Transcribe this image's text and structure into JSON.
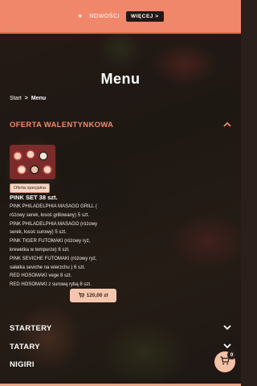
{
  "promo": {
    "icon": "star-icon",
    "text": "NOWOŚCI",
    "more_label": "WIĘCEJ >"
  },
  "page": {
    "title": "Menu"
  },
  "breadcrumb": {
    "home": "Start",
    "separator": ">",
    "current": "Menu"
  },
  "sections": {
    "oferta": "OFERTA WALENTYNKOWA",
    "startery": "STARTERY",
    "tatary": "TATARY",
    "nigiri": "NIGIRI"
  },
  "product": {
    "badge": "Oferta specjalna",
    "name": "PINK SET 38 szt.",
    "description_lines": [
      "PINK PHILADELPHIA MASAGO GRILL (",
      "różowy serek, łosoś grillowany) 5 szt.",
      "PINK PHILADELPHIA MASAGO (różowy",
      "serek, łosoś surowy) 5 szt.",
      "PINK TIGER FUTOMAKI (różowy ryż,",
      "krewetka w tempurze) 6 szt.",
      "PINK SEVICHE FUTOMAKI (różowy ryż,",
      "sałatka seviche na wierzchu ) 6 szt.",
      "RED HOSOMAKI vege 8 szt.",
      "RED HOSOMAKI z surową rybą 8 szt."
    ],
    "price": "120,00 zł"
  },
  "cart": {
    "count": "0"
  },
  "colors": {
    "accent": "#f08a6a",
    "promo_bg": "#f1876a",
    "button_bg": "#f4c6ae"
  }
}
